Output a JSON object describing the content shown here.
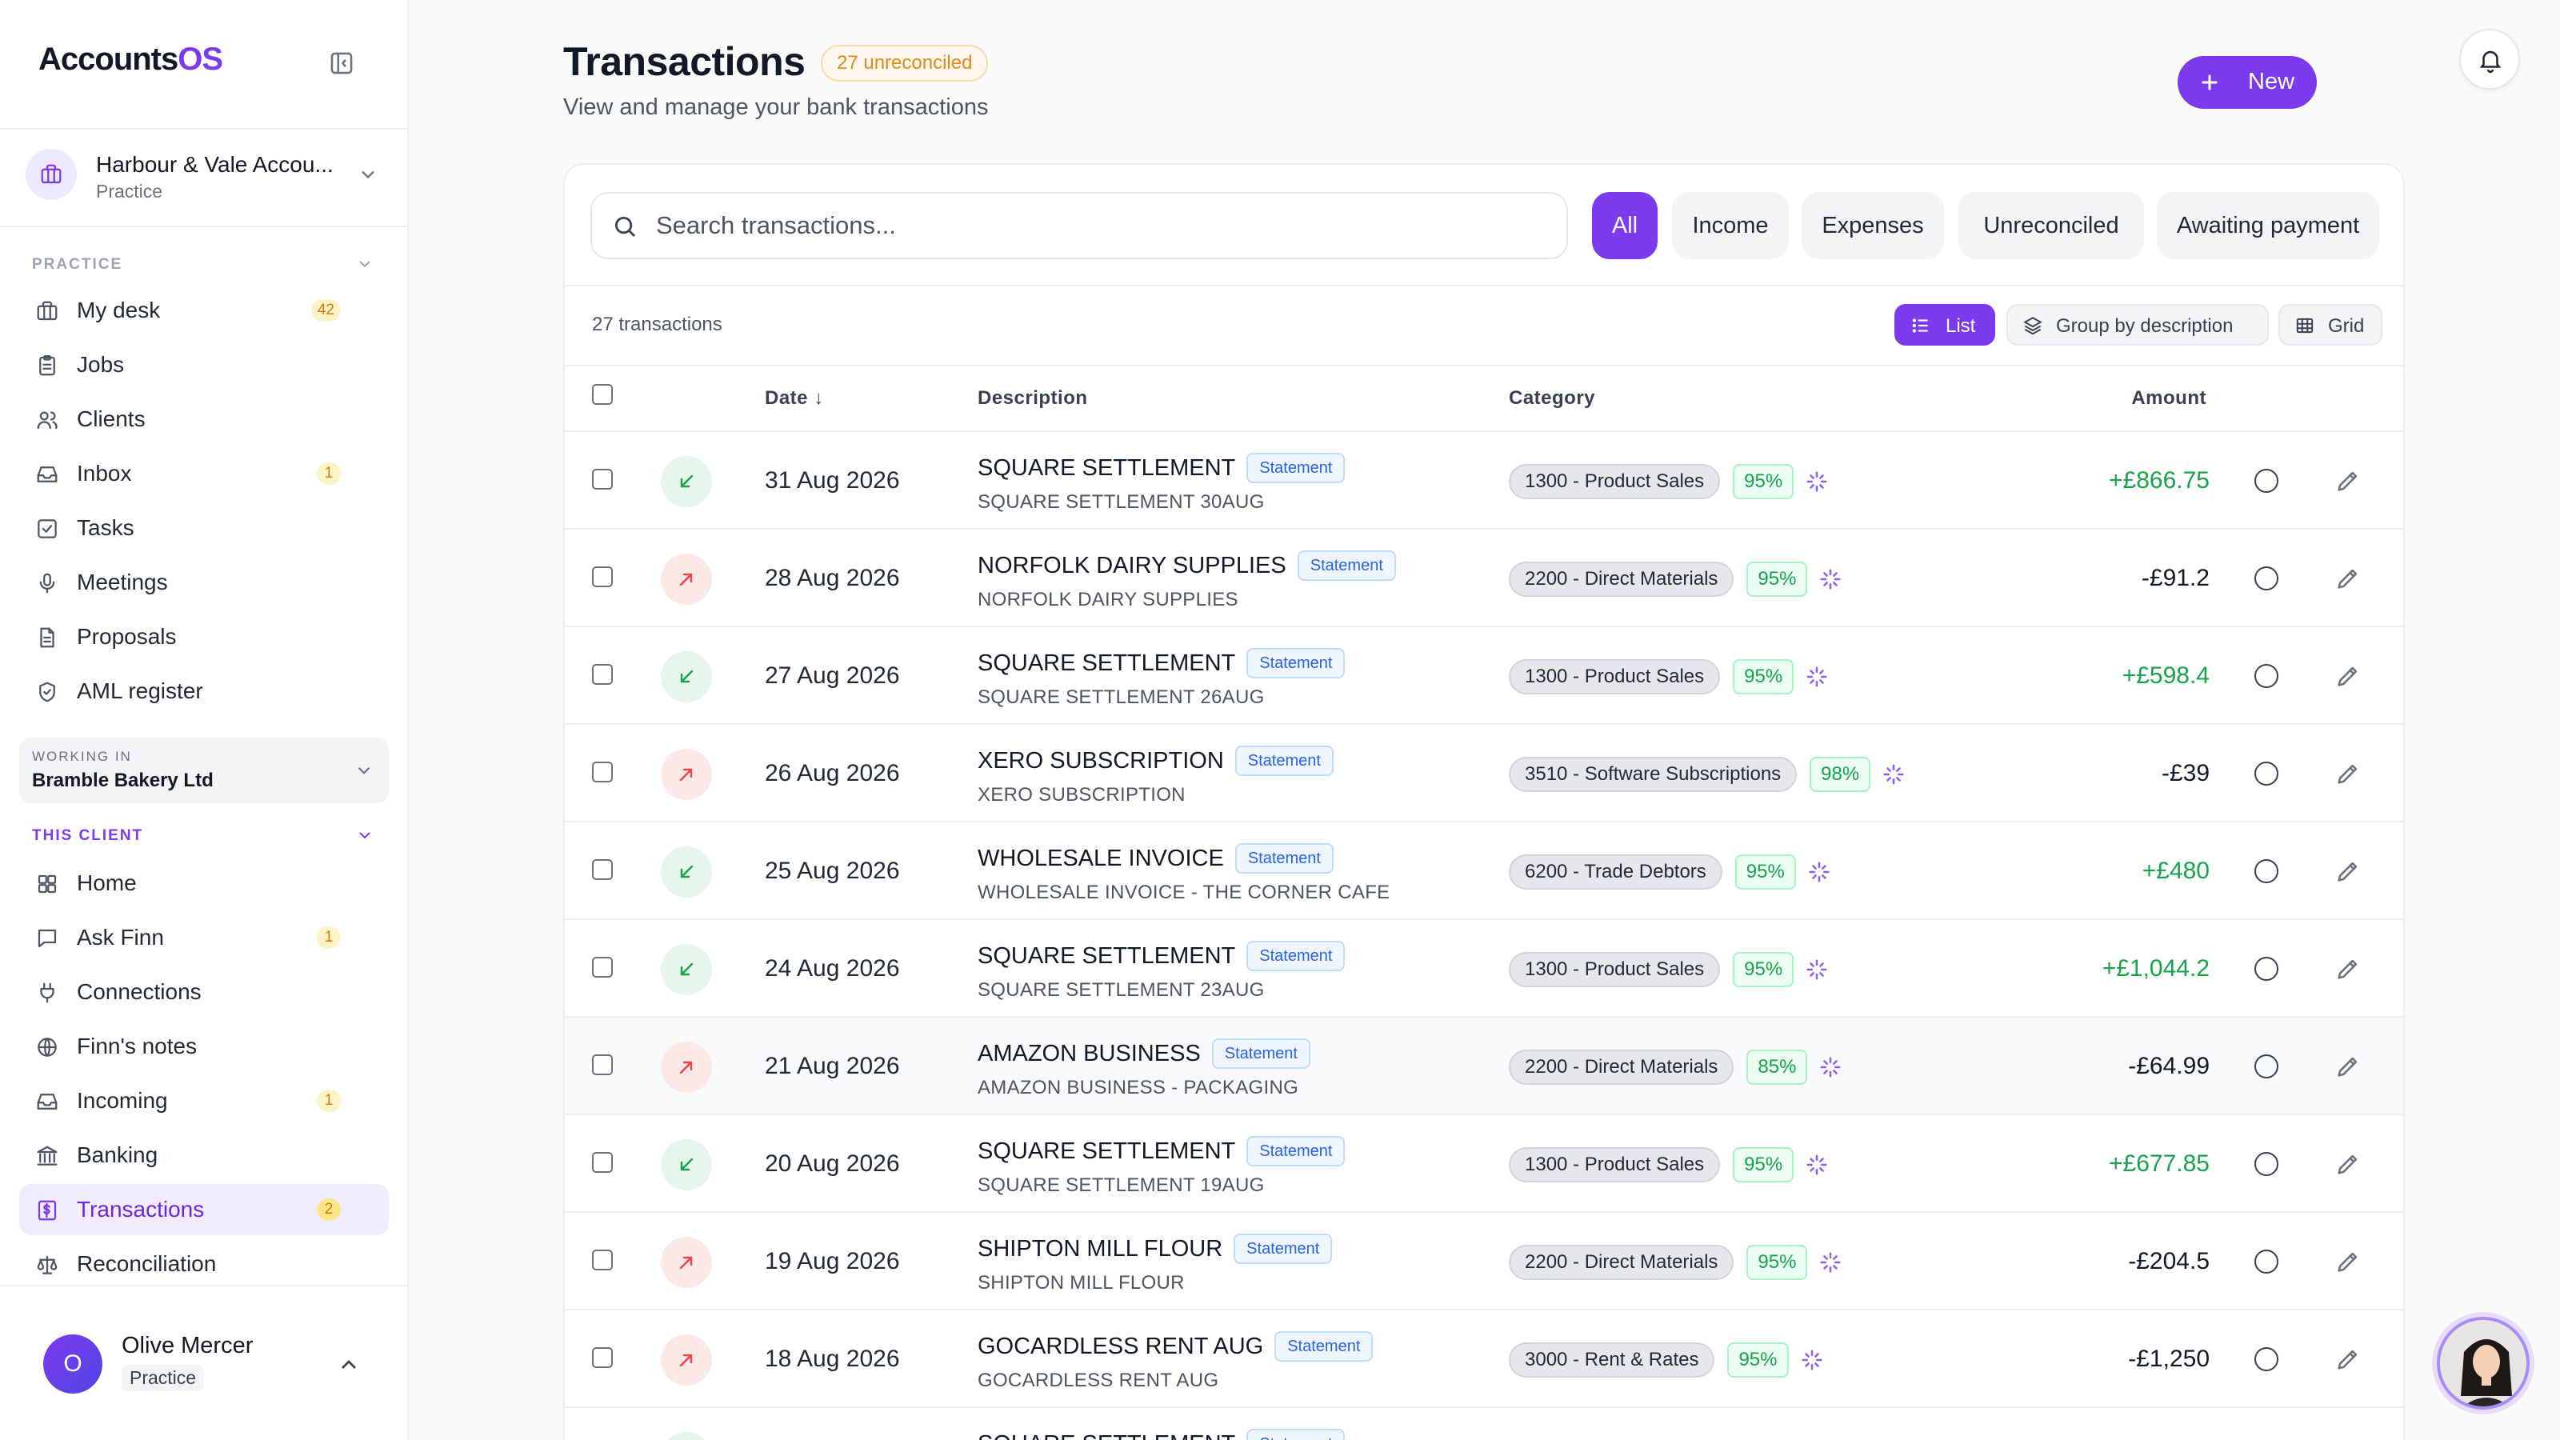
{
  "app": {
    "logo_main": "Accounts",
    "logo_accent": "OS"
  },
  "practice": {
    "name": "Harbour & Vale Accou...",
    "type": "Practice"
  },
  "sidebar": {
    "practice_section_label": "PRACTICE",
    "practice_items": [
      {
        "label": "My desk",
        "badge": "42",
        "icon": "briefcase-icon"
      },
      {
        "label": "Jobs",
        "icon": "clipboard-icon"
      },
      {
        "label": "Clients",
        "icon": "users-icon"
      },
      {
        "label": "Inbox",
        "badge": "1",
        "icon": "inbox-icon"
      },
      {
        "label": "Tasks",
        "icon": "checkbox-icon"
      },
      {
        "label": "Meetings",
        "icon": "microphone-icon"
      },
      {
        "label": "Proposals",
        "icon": "document-icon"
      },
      {
        "label": "AML register",
        "icon": "shield-icon"
      }
    ],
    "working_in_label": "WORKING IN",
    "working_in_client": "Bramble Bakery Ltd",
    "client_section_label": "THIS CLIENT",
    "client_items": [
      {
        "label": "Home",
        "icon": "grid-icon"
      },
      {
        "label": "Ask Finn",
        "badge": "1",
        "icon": "chat-icon"
      },
      {
        "label": "Connections",
        "icon": "plug-icon"
      },
      {
        "label": "Finn's notes",
        "icon": "globe-icon"
      },
      {
        "label": "Incoming",
        "badge": "1",
        "icon": "inbox-icon"
      },
      {
        "label": "Banking",
        "icon": "bank-icon"
      },
      {
        "label": "Transactions",
        "badge": "2",
        "icon": "receipt-icon",
        "active": true
      },
      {
        "label": "Reconciliation",
        "icon": "scale-icon"
      }
    ]
  },
  "user": {
    "initial": "O",
    "name": "Olive Mercer",
    "role": "Practice"
  },
  "header": {
    "title": "Transactions",
    "badge": "27 unreconciled",
    "subtitle": "View and manage your bank transactions",
    "new_label": "New"
  },
  "search": {
    "placeholder": "Search transactions..."
  },
  "filters": [
    "All",
    "Income",
    "Expenses",
    "Unreconciled",
    "Awaiting payment"
  ],
  "active_filter": "All",
  "toolbar": {
    "count": "27 transactions",
    "list_label": "List",
    "group_label": "Group by description",
    "grid_label": "Grid"
  },
  "table": {
    "headers": {
      "date": "Date ↓",
      "description": "Description",
      "category": "Category",
      "amount": "Amount"
    },
    "tag_label": "Statement",
    "rows": [
      {
        "dir": "in",
        "date": "31 Aug 2026",
        "description": "SQUARE SETTLEMENT",
        "sub": "SQUARE SETTLEMENT 30AUG",
        "category": "1300 - Product Sales",
        "confidence": "95%",
        "amount": "+£866.75"
      },
      {
        "dir": "out",
        "date": "28 Aug 2026",
        "description": "NORFOLK DAIRY SUPPLIES",
        "sub": "NORFOLK DAIRY SUPPLIES",
        "category": "2200 - Direct Materials",
        "confidence": "95%",
        "amount": "-£91.2"
      },
      {
        "dir": "in",
        "date": "27 Aug 2026",
        "description": "SQUARE SETTLEMENT",
        "sub": "SQUARE SETTLEMENT 26AUG",
        "category": "1300 - Product Sales",
        "confidence": "95%",
        "amount": "+£598.4"
      },
      {
        "dir": "out",
        "date": "26 Aug 2026",
        "description": "XERO SUBSCRIPTION",
        "sub": "XERO SUBSCRIPTION",
        "category": "3510 - Software Subscriptions",
        "confidence": "98%",
        "amount": "-£39"
      },
      {
        "dir": "in",
        "date": "25 Aug 2026",
        "description": "WHOLESALE INVOICE",
        "sub": "WHOLESALE INVOICE - THE CORNER CAFE",
        "category": "6200 - Trade Debtors",
        "confidence": "95%",
        "amount": "+£480"
      },
      {
        "dir": "in",
        "date": "24 Aug 2026",
        "description": "SQUARE SETTLEMENT",
        "sub": "SQUARE SETTLEMENT 23AUG",
        "category": "1300 - Product Sales",
        "confidence": "95%",
        "amount": "+£1,044.2"
      },
      {
        "dir": "out",
        "date": "21 Aug 2026",
        "description": "AMAZON BUSINESS",
        "sub": "AMAZON BUSINESS - PACKAGING",
        "category": "2200 - Direct Materials",
        "confidence": "85%",
        "amount": "-£64.99",
        "hover": true
      },
      {
        "dir": "in",
        "date": "20 Aug 2026",
        "description": "SQUARE SETTLEMENT",
        "sub": "SQUARE SETTLEMENT 19AUG",
        "category": "1300 - Product Sales",
        "confidence": "95%",
        "amount": "+£677.85"
      },
      {
        "dir": "out",
        "date": "19 Aug 2026",
        "description": "SHIPTON MILL FLOUR",
        "sub": "SHIPTON MILL FLOUR",
        "category": "2200 - Direct Materials",
        "confidence": "95%",
        "amount": "-£204.5"
      },
      {
        "dir": "out",
        "date": "18 Aug 2026",
        "description": "GOCARDLESS RENT AUG",
        "sub": "GOCARDLESS RENT AUG",
        "category": "3000 - Rent & Rates",
        "confidence": "95%",
        "amount": "-£1,250"
      },
      {
        "dir": "in",
        "date": "",
        "description": "SQUARE SETTLEMENT",
        "sub": "",
        "category": "",
        "confidence": "",
        "amount": ""
      }
    ]
  },
  "colors": {
    "accent": "#7c3aed",
    "positive": "#16a34a",
    "negative": "#ef4444",
    "badge": "#d97706"
  }
}
